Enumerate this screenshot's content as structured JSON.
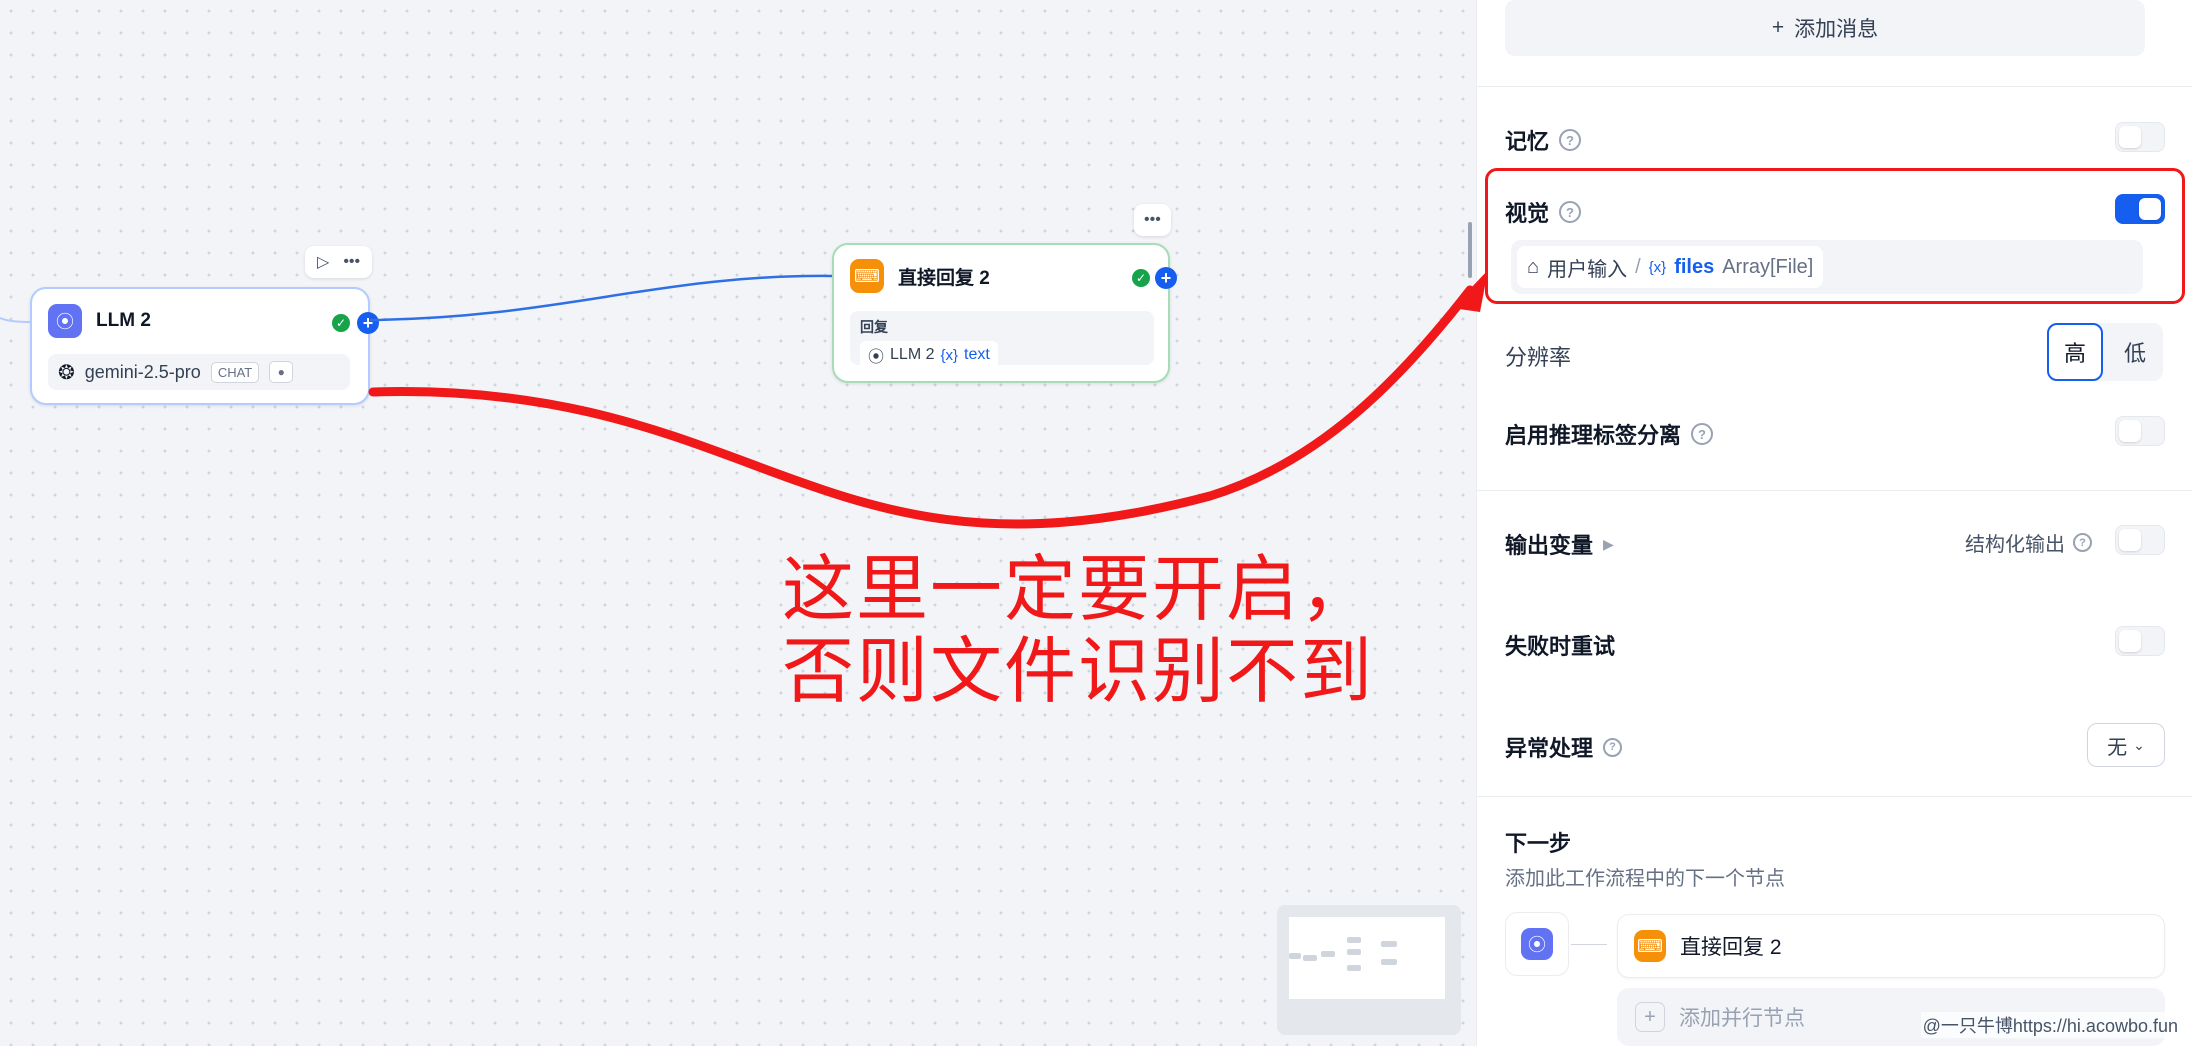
{
  "canvas": {
    "llm_node": {
      "title": "LLM 2",
      "model": "gemini-2.5-pro",
      "mode_badge": "CHAT"
    },
    "reply_node": {
      "title": "直接回复 2",
      "section_label": "回复",
      "var_source": "LLM 2",
      "var_name": "text"
    },
    "annotation": {
      "line1": "这里一定要开启，",
      "line2": "否则文件识别不到"
    }
  },
  "panel": {
    "add_message_label": "添加消息",
    "memory": {
      "label": "记忆",
      "enabled": false
    },
    "vision": {
      "label": "视觉",
      "enabled": true,
      "var_source": "用户输入",
      "var_separator": "/",
      "var_name": "files",
      "var_type": "Array[File]"
    },
    "resolution": {
      "label": "分辨率",
      "options": [
        "高",
        "低"
      ],
      "selected": "高"
    },
    "reasoning_split": {
      "label": "启用推理标签分离",
      "enabled": false
    },
    "output_vars": {
      "label": "输出变量",
      "structured_label": "结构化输出",
      "structured_enabled": false
    },
    "retry": {
      "label": "失败时重试",
      "enabled": false
    },
    "error_handling": {
      "label": "异常处理",
      "value": "无"
    },
    "next_step": {
      "title": "下一步",
      "subtitle": "添加此工作流程中的下一个节点",
      "next_node_title": "直接回复 2",
      "add_parallel_label": "添加并行节点"
    }
  },
  "watermark": "@一只牛博https://hi.acowbo.fun",
  "colors": {
    "accent": "#155eef",
    "annotation": "#f01818",
    "llm_icon": "#6172f3",
    "reply_icon": "#f79009"
  }
}
